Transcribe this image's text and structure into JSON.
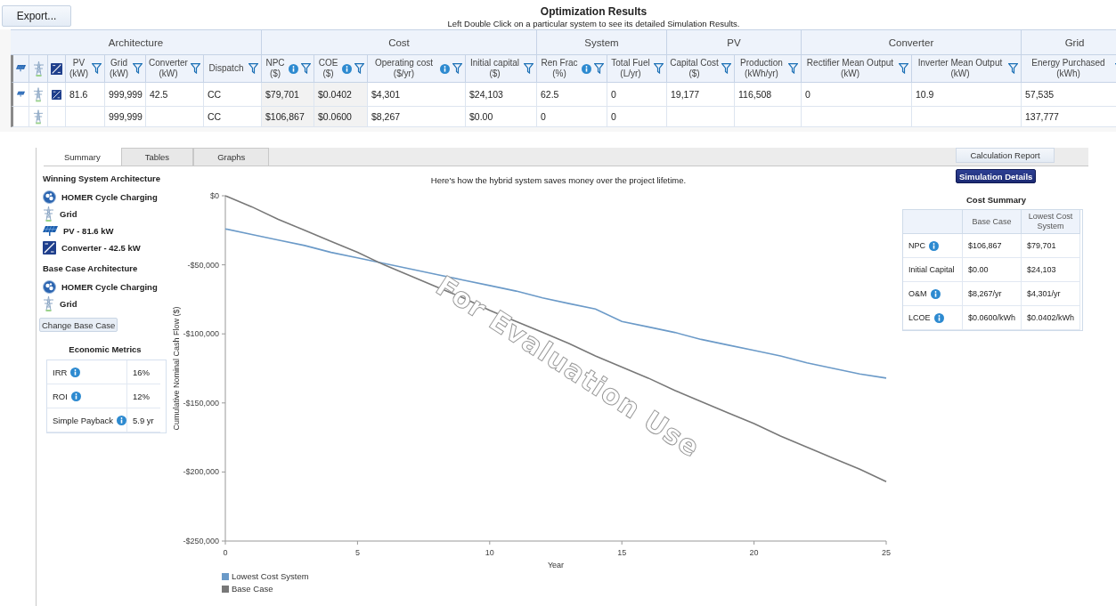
{
  "export_button": "Export...",
  "header": {
    "title": "Optimization Results",
    "subtitle": "Left Double Click on a particular system to see its detailed Simulation Results."
  },
  "results_table": {
    "groups": [
      {
        "label": "Architecture",
        "columns": [
          {
            "kind": "solar"
          },
          {
            "kind": "tower"
          },
          {
            "kind": "converter"
          },
          {
            "kind": "text",
            "label": "PV",
            "unit": "(kW)",
            "info": false,
            "highlighted": false
          },
          {
            "kind": "text",
            "label": "Grid",
            "unit": "(kW)",
            "info": false,
            "highlighted": false
          },
          {
            "kind": "text",
            "label": "Converter",
            "unit": "(kW)",
            "info": false,
            "highlighted": false
          },
          {
            "kind": "text",
            "label": "Dispatch",
            "info": false,
            "highlighted": false
          }
        ]
      },
      {
        "label": "Cost",
        "columns": [
          {
            "kind": "text",
            "label": "NPC",
            "unit": "($)",
            "info": true,
            "highlighted": true
          },
          {
            "kind": "text",
            "label": "COE",
            "unit": "($)",
            "info": true,
            "highlighted": true
          },
          {
            "kind": "text",
            "label": "Operating cost",
            "unit": "($/yr)",
            "info": true,
            "highlighted": false
          },
          {
            "kind": "text",
            "label": "Initial capital",
            "unit": "($)",
            "info": false,
            "highlighted": false
          }
        ]
      },
      {
        "label": "System",
        "columns": [
          {
            "kind": "text",
            "label": "Ren Frac",
            "unit": "(%)",
            "info": true,
            "highlighted": false
          },
          {
            "kind": "text",
            "label": "Total Fuel",
            "unit": "(L/yr)",
            "info": false,
            "highlighted": false
          }
        ]
      },
      {
        "label": "PV",
        "columns": [
          {
            "kind": "text",
            "label": "Capital Cost",
            "unit": "($)",
            "info": false,
            "highlighted": false
          },
          {
            "kind": "text",
            "label": "Production",
            "unit": "(kWh/yr)",
            "info": false,
            "highlighted": false
          }
        ]
      },
      {
        "label": "Converter",
        "columns": [
          {
            "kind": "text",
            "label": "Rectifier Mean Output",
            "unit": "(kW)",
            "info": false,
            "highlighted": false
          },
          {
            "kind": "text",
            "label": "Inverter Mean Output",
            "unit": "(kW)",
            "info": false,
            "highlighted": false
          }
        ]
      },
      {
        "label": "Grid",
        "columns": [
          {
            "kind": "text",
            "label": "Energy Purchased",
            "unit": "(kWh)",
            "info": false,
            "highlighted": false
          }
        ]
      }
    ],
    "rows": [
      {
        "cells": [
          true,
          true,
          true,
          "81.6",
          "999,999",
          "42.5",
          "CC",
          "$79,701",
          "$0.0402",
          "$4,301",
          "$24,103",
          "62.5",
          "0",
          "19,177",
          "116,508",
          "0",
          "10.9",
          "57,535"
        ]
      },
      {
        "cells": [
          false,
          true,
          false,
          null,
          "999,999",
          null,
          "CC",
          "$106,867",
          "$0.0600",
          "$8,267",
          "$0.00",
          "0",
          "0",
          null,
          null,
          null,
          null,
          "137,777"
        ]
      }
    ]
  },
  "tabs": [
    {
      "label": "Summary",
      "selected": true
    },
    {
      "label": "Tables",
      "selected": false
    },
    {
      "label": "Graphs",
      "selected": false
    }
  ],
  "calculation_report_button": "Calculation Report",
  "simulation_details_button": "Simulation Details",
  "architectures": [
    {
      "title": "Winning System Architecture",
      "items": [
        {
          "kind": "homer",
          "label": "HOMER Cycle Charging"
        },
        {
          "kind": "tower",
          "label": "Grid"
        },
        {
          "kind": "solar",
          "label": "PV - 81.6 kW"
        },
        {
          "kind": "converter",
          "label": "Converter - 42.5 kW"
        }
      ]
    },
    {
      "title": "Base Case Architecture",
      "items": [
        {
          "kind": "homer",
          "label": "HOMER Cycle Charging"
        },
        {
          "kind": "tower",
          "label": "Grid"
        }
      ]
    }
  ],
  "change_base_case_button": "Change Base Case",
  "economic_metrics": {
    "title": "Economic Metrics",
    "rows": [
      {
        "label": "IRR",
        "info": true,
        "value": "16%"
      },
      {
        "label": "ROI",
        "info": true,
        "value": "12%"
      },
      {
        "label": "Simple Payback",
        "info": true,
        "value": "5.9 yr"
      }
    ]
  },
  "chart": {
    "caption": "Here's how the hybrid system saves money over the project lifetime.",
    "watermark": "For Evaluation Use",
    "chart_data": {
      "type": "line",
      "xlabel": "Year",
      "ylabel": "Cumulative Nominal Cash Flow ($)",
      "x": [
        0,
        1,
        2,
        3,
        4,
        5,
        6,
        7,
        8,
        9,
        10,
        11,
        12,
        13,
        14,
        15,
        16,
        17,
        18,
        19,
        20,
        21,
        22,
        23,
        24,
        25
      ],
      "series": [
        {
          "name": "Lowest Cost System",
          "color": "#6b9ac8",
          "values": [
            -24000,
            -28000,
            -32000,
            -36000,
            -41000,
            -45000,
            -49000,
            -53000,
            -57000,
            -61000,
            -65000,
            -69000,
            -74000,
            -78000,
            -82000,
            -91000,
            -95000,
            -99000,
            -104000,
            -108000,
            -112000,
            -116000,
            -121000,
            -125000,
            -129000,
            -132000
          ]
        },
        {
          "name": "Base Case",
          "color": "#787878",
          "values": [
            0,
            -8000,
            -17000,
            -25000,
            -33000,
            -41000,
            -50000,
            -58000,
            -66000,
            -74000,
            -83000,
            -91000,
            -99000,
            -107000,
            -116000,
            -124000,
            -132000,
            -141000,
            -149000,
            -157000,
            -165000,
            -174000,
            -182000,
            -190000,
            -198000,
            -207000
          ]
        }
      ],
      "xlim": [
        0,
        25
      ],
      "ylim": [
        -250000,
        0
      ],
      "xticks": [
        0,
        5,
        10,
        15,
        20,
        25
      ],
      "yticks": [
        {
          "value": 0,
          "label": "$0"
        },
        {
          "value": -50000,
          "label": "-$50,000"
        },
        {
          "value": -100000,
          "label": "-$100,000"
        },
        {
          "value": -150000,
          "label": "-$150,000"
        },
        {
          "value": -200000,
          "label": "-$200,000"
        },
        {
          "value": -250000,
          "label": "-$250,000"
        }
      ]
    }
  },
  "cost_summary": {
    "title": "Cost Summary",
    "columns": [
      "Base Case",
      "Lowest Cost System"
    ],
    "rows": [
      {
        "label": "NPC",
        "info": true,
        "values": [
          "$106,867",
          "$79,701"
        ]
      },
      {
        "label": "Initial Capital",
        "info": false,
        "values": [
          "$0.00",
          "$24,103"
        ]
      },
      {
        "label": "O&M",
        "info": true,
        "values": [
          "$8,267/yr",
          "$4,301/yr"
        ]
      },
      {
        "label": "LCOE",
        "info": true,
        "values": [
          "$0.0600/kWh",
          "$0.0402/kWh"
        ]
      }
    ]
  }
}
